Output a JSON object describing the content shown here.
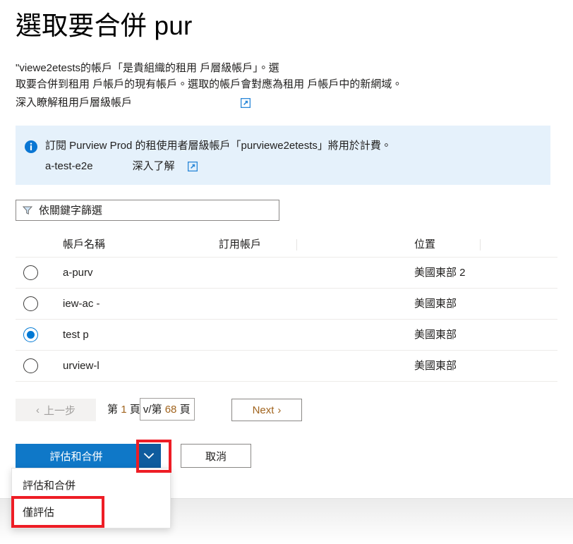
{
  "page": {
    "title": "選取要合併 pur"
  },
  "description": {
    "line1": "\"viewe2etests的帳戶「是貴組織的租用 戶層級帳戶」。選",
    "line2": "取要合併到租用 戶帳戶的現有帳戶。選取的帳戶會對應為租用 戶帳戶中的新網域。",
    "learn_more_link": "深入瞭解租用戶層級帳戶",
    "external_link_icon": "external-link-icon"
  },
  "info_banner": {
    "icon": "info-circle-icon",
    "message": "訂閱 Purview Prod 的租使用者層級帳戶「purviewe2etests」將用於計費。",
    "sub_name": "a-test-e2e",
    "learn_more_label": "深入了解",
    "external_link_icon": "external-link-icon",
    "background_color": "#e5f1fb",
    "icon_color": "#0078d4"
  },
  "filter": {
    "icon": "filter-funnel-icon",
    "placeholder": "依關鍵字篩選",
    "value": ""
  },
  "table": {
    "columns": [
      "帳戶名稱",
      "訂用帳戶",
      "位置"
    ],
    "rows": [
      {
        "selected": false,
        "name": "a-purv",
        "subscription": "",
        "location": "美國東部 2"
      },
      {
        "selected": false,
        "name": "iew-ac -",
        "subscription": "",
        "location": "美國東部"
      },
      {
        "selected": true,
        "name": "test p",
        "subscription": "",
        "location": "美國東部"
      },
      {
        "selected": false,
        "name": "urview-l",
        "subscription": "",
        "location": "美國東部"
      }
    ]
  },
  "pagination": {
    "prev_label": "上一步",
    "prev_chevron": "chevron-left-icon",
    "page_prefix": "第",
    "current_page": "1",
    "page_middle": "頁 v/第",
    "total_pages": "68",
    "page_suffix": "頁",
    "next_label": "Next",
    "next_chevron": "chevron-right-icon"
  },
  "actions": {
    "primary_label": "評估和合併",
    "caret_icon": "chevron-down-icon",
    "cancel_label": "取消",
    "primary_color": "#0f78c8",
    "caret_color": "#0f5c9e"
  },
  "dropdown_menu": {
    "items": [
      {
        "label": "評估和合併"
      },
      {
        "label": "僅評估"
      }
    ]
  },
  "annotations": {
    "highlight_color": "#ee1d25",
    "caret_box": "dropdown-caret-highlight",
    "menu_box": "evaluate-only-highlight"
  }
}
